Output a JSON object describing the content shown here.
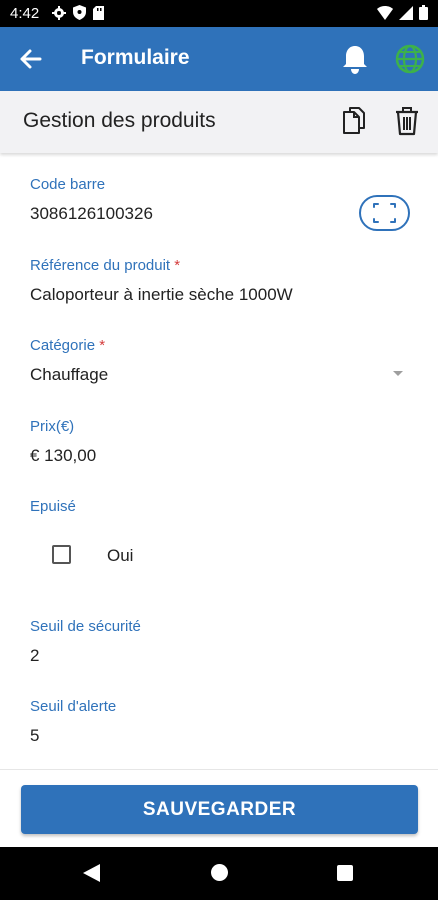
{
  "status_bar": {
    "time": "4:42",
    "left_icons": [
      "gear-icon",
      "shield-icon",
      "sd-card-icon"
    ],
    "right_icons": [
      "wifi-icon",
      "signal-icon",
      "battery-icon"
    ]
  },
  "app_bar": {
    "title": "Formulaire",
    "back_icon": "arrow-left-icon",
    "bell_icon": "bell-icon",
    "globe_icon": "globe-icon",
    "colors": {
      "background": "#2f72ba",
      "globe": "#3db14a"
    }
  },
  "sub_header": {
    "title": "Gestion des produits",
    "copy_icon": "copy-icon",
    "delete_icon": "trash-icon"
  },
  "fields": {
    "barcode": {
      "label": "Code barre",
      "value": "3086126100326",
      "scan_icon": "scan-frame-icon"
    },
    "reference": {
      "label": "Référence du produit",
      "required_mark": "*",
      "value": "Caloporteur à inertie sèche 1000W"
    },
    "category": {
      "label": "Catégorie",
      "required_mark": "*",
      "value": "Chauffage"
    },
    "price": {
      "label": "Prix(€)",
      "value": "€ 130,00"
    },
    "out_of_stock": {
      "label": "Epuisé",
      "option_label": "Oui",
      "checked": false
    },
    "safety_threshold": {
      "label": "Seuil de sécurité",
      "value": "2"
    },
    "alert_threshold": {
      "label": "Seuil d'alerte",
      "value": "5"
    }
  },
  "actions": {
    "save_label": "SAUVEGARDER"
  },
  "colors": {
    "accent": "#2f72ba",
    "required": "#d43b3b"
  },
  "nav_bar": {
    "icons": [
      "nav-back-icon",
      "nav-home-icon",
      "nav-recents-icon"
    ]
  }
}
